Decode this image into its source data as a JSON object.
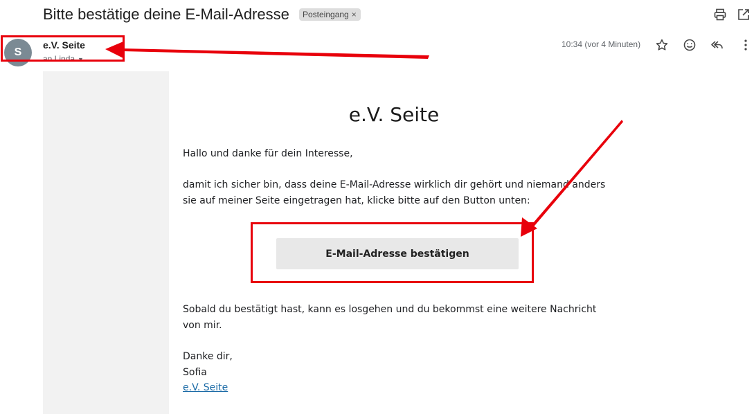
{
  "header": {
    "subject": "Bitte bestätige deine E-Mail-Adresse",
    "label_chip": "Posteingang",
    "label_remove": "×"
  },
  "message": {
    "avatar_letter": "S",
    "sender_name": "e.V. Seite",
    "recipient": "an Linda",
    "timestamp": "10:34 (vor 4 Minuten)"
  },
  "email": {
    "brand": "e.V. Seite",
    "greeting": "Hallo und danke für dein Interesse,",
    "intro_line1": "damit ich sicher bin, dass deine E-Mail-Adresse wirklich dir gehört und niemand anders",
    "intro_line2": "sie auf meiner Seite eingetragen hat, klicke bitte auf den Button unten:",
    "button_label": "E-Mail-Adresse bestätigen",
    "after_line1": "Sobald du bestätigt hast, kann es losgehen und du bekommst eine weitere Nachricht",
    "after_line2": "von mir.",
    "closing": "Danke dir,",
    "signature_name": "Sofia",
    "signature_link": "e.V. Seite"
  },
  "icons": [
    "print-icon",
    "open-in-new-window-icon",
    "star-icon",
    "emoji-icon",
    "reply-all-icon",
    "more-vertical-icon",
    "chevron-down-icon"
  ],
  "colors": {
    "annotation_red": "#e8000b",
    "button_bg": "#e8e8e8",
    "link": "#1a6aa6",
    "avatar": "#7b8a94"
  }
}
